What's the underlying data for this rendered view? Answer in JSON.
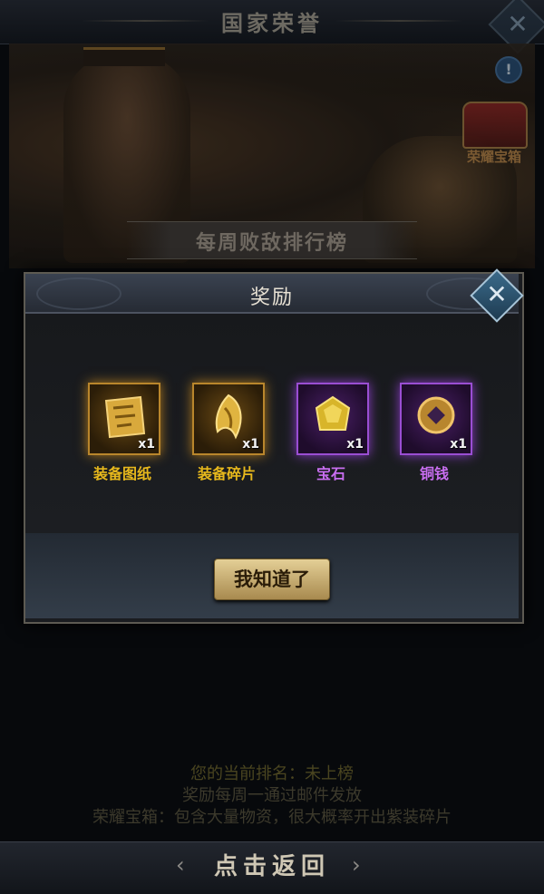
{
  "background": {
    "title": "国家荣誉",
    "chest_label": "荣耀宝箱",
    "info_glyph": "!",
    "weekly_title": "每周败敌排行榜",
    "close_glyph": "✕",
    "footer": {
      "rank_line": "您的当前排名：未上榜",
      "mail_line": "奖励每周一通过邮件发放",
      "chest_line": "荣耀宝箱：包含大量物资，很大概率开出紫装碎片"
    },
    "back": {
      "label": "点击返回",
      "left_arrow": "‹",
      "right_arrow": "›"
    }
  },
  "dialog": {
    "title": "奖励",
    "close_glyph": "✕",
    "items": [
      {
        "name": "装备图纸",
        "qty": "x1",
        "rarity": "gold",
        "icon": "blueprint-scroll-icon"
      },
      {
        "name": "装备碎片",
        "qty": "x1",
        "rarity": "gold",
        "icon": "equipment-fragment-icon"
      },
      {
        "name": "宝石",
        "qty": "x1",
        "rarity": "purple",
        "icon": "gem-icon"
      },
      {
        "name": "铜钱",
        "qty": "x1",
        "rarity": "purple",
        "icon": "copper-coin-icon"
      }
    ],
    "confirm_label": "我知道了"
  },
  "colors": {
    "gold_text": "#e7b81c",
    "purple_text": "#c86ef0",
    "button_gold": "#d4bd84"
  }
}
